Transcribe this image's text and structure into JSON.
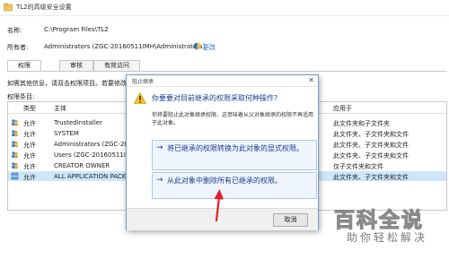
{
  "window": {
    "title": "TL2的高级安全设置"
  },
  "header": {
    "name_label": "名称:",
    "name_value": "C:\\Program Files\\TL2",
    "owner_label": "所有者:",
    "owner_value": "Administrators (ZGC-20160511IMH\\Administrators)",
    "change_link": "更改"
  },
  "tabs": [
    {
      "label": "权限"
    },
    {
      "label": "审核"
    },
    {
      "label": "有效访问"
    }
  ],
  "info_text": "如需其他信息，请双击权限项目。若要修改",
  "entries_label": "权限条目:",
  "grid": {
    "headers": [
      "类型",
      "主体",
      "应用于"
    ],
    "rows": [
      {
        "type": "允许",
        "principal": "TrustedInstaller",
        "applies": "此文件夹和子文件夹"
      },
      {
        "type": "允许",
        "principal": "SYSTEM",
        "applies": "此文件夹、子文件夹和文件"
      },
      {
        "type": "允许",
        "principal": "Administrators (ZGC-2016",
        "applies": "此文件夹、子文件夹和文件"
      },
      {
        "type": "允许",
        "principal": "Users (ZGC-20160511IMH\\",
        "applies": "此文件夹、子文件夹和文件"
      },
      {
        "type": "允许",
        "principal": "CREATOR OWNER",
        "applies": "仅子文件夹和文件"
      },
      {
        "type": "允许",
        "principal": "ALL APPLICATION PACKAG",
        "applies": "此文件夹、子文件夹和文件"
      }
    ]
  },
  "dialog": {
    "title": "阻止继承",
    "heading": "你要要对目前继承的权限采取何种操作?",
    "description": "你将要阻止此对象继承权限，这意味着从父对象继承的权限不再适用于此对象。",
    "option1": "将已继承的权限转换为此对象的显式权限。",
    "option2": "从此对象中删除所有已继承的权限。",
    "cancel": "取消"
  },
  "watermark": {
    "title": "百科全说",
    "subtitle": "助你轻松解决"
  },
  "colors": {
    "accent": "#1b3d8f",
    "link": "#1a6fd0",
    "selection": "#cde6fb",
    "annotation_arrow": "#e0202a"
  }
}
